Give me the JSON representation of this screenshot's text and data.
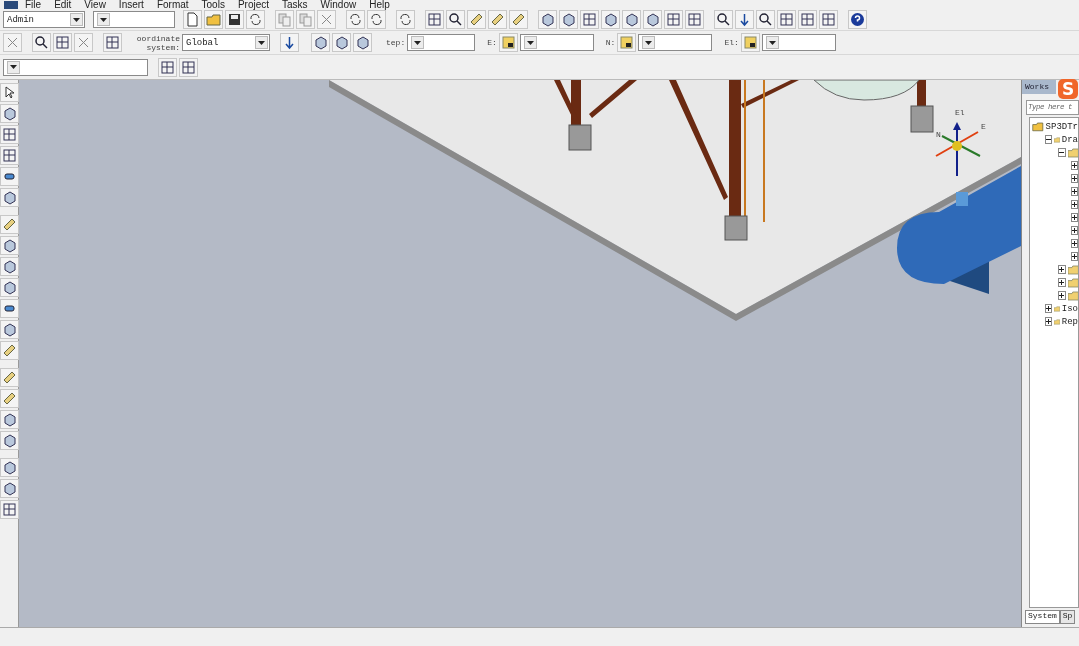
{
  "menu": [
    {
      "label": "File"
    },
    {
      "label": "Edit"
    },
    {
      "label": "View"
    },
    {
      "label": "Insert"
    },
    {
      "label": "Format"
    },
    {
      "label": "Tools"
    },
    {
      "label": "Project"
    },
    {
      "label": "Tasks"
    },
    {
      "label": "Window"
    },
    {
      "label": "Help"
    }
  ],
  "toolbar": {
    "role": "Admin"
  },
  "coordinate_bar": {
    "label": "oordinate system:",
    "system": "Global",
    "step_label": "tep:",
    "fields": [
      {
        "label": "E:"
      },
      {
        "label": "N:"
      },
      {
        "label": "El:"
      }
    ]
  },
  "viewport": {
    "axis_labels": [
      "El",
      "N",
      "E"
    ]
  },
  "workspace": {
    "tab": "Works",
    "search": {
      "placeholder": "Type here t"
    },
    "tree": [
      {
        "label": "SP3DTr",
        "children": [
          {
            "label": "Dra",
            "expanded": true,
            "children": [
              {
                "expanded": true,
                "children": [
                  {
                    "expanded": false
                  },
                  {
                    "expanded": false
                  },
                  {
                    "expanded": false
                  },
                  {
                    "expanded": false
                  },
                  {
                    "expanded": false
                  },
                  {
                    "expanded": false
                  },
                  {
                    "expanded": false
                  },
                  {
                    "expanded": false
                  }
                ]
              },
              {
                "expanded": false
              },
              {
                "expanded": false
              },
              {
                "expanded": false
              }
            ]
          },
          {
            "label": "Iso",
            "expanded": false
          },
          {
            "label": "Rep",
            "expanded": false
          }
        ]
      }
    ],
    "bottom_tabs": [
      {
        "label": "System",
        "selected": true
      },
      {
        "label": "Sp",
        "selected": false
      }
    ]
  },
  "ime_badge": {
    "letter": "S"
  }
}
